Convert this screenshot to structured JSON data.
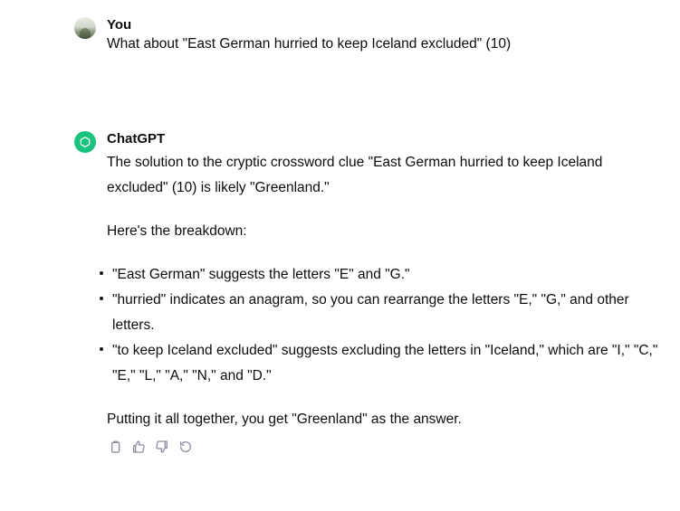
{
  "conversation": {
    "user": {
      "name": "You",
      "message": "What about \"East German hurried to keep Iceland excluded\" (10)"
    },
    "assistant": {
      "name": "ChatGPT",
      "intro": "The solution to the cryptic crossword clue \"East German hurried to keep Iceland excluded\" (10) is likely \"Greenland.\"",
      "breakdown_heading": "Here's the breakdown:",
      "bullets": [
        "\"East German\" suggests the letters \"E\" and \"G.\"",
        "\"hurried\" indicates an anagram, so you can rearrange the letters \"E,\" \"G,\" and other letters.",
        "\"to keep Iceland excluded\" suggests excluding the letters in \"Iceland,\" which are \"I,\" \"C,\" \"E,\" \"L,\" \"A,\" \"N,\" and \"D.\""
      ],
      "conclusion": "Putting it all together, you get \"Greenland\" as the answer."
    }
  },
  "actions": [
    {
      "icon": "copy-icon"
    },
    {
      "icon": "thumbs-up-icon"
    },
    {
      "icon": "thumbs-down-icon"
    },
    {
      "icon": "regenerate-icon"
    }
  ],
  "colors": {
    "text": "#0d0d0d",
    "gpt_avatar_bg": "#19c37d",
    "icon_gray": "#8e8ea0"
  }
}
